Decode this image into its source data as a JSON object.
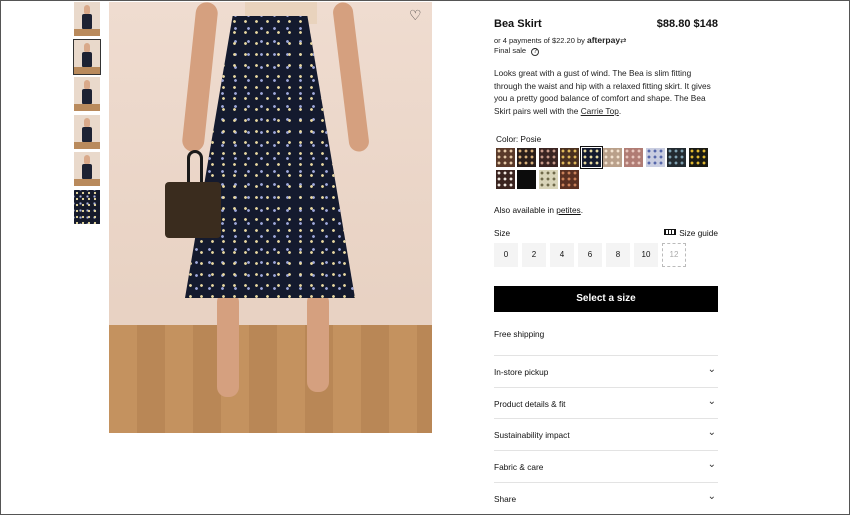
{
  "gallery": {
    "thumb_count": 6,
    "selected_index": 1
  },
  "product": {
    "title": "Bea Skirt",
    "sale_price": "$88.80",
    "original_price": "$148",
    "payments_text": "or 4 payments of $22.20 by",
    "payments_brand": "afterpay",
    "final_sale": "Final sale",
    "description_main": "Looks great with a gust of wind. The Bea is slim fitting through the waist and hip with a relaxed fitting skirt. It gives you a pretty good balance of comfort and shape. The Bea Skirt pairs well with the ",
    "description_link": "Carrie Top",
    "description_end": "."
  },
  "color": {
    "label": "Color: Posie",
    "selected_index": 4,
    "swatches": [
      {
        "name": "swatch-1",
        "bg": "#5a3a2a",
        "dot": "#e6c9a8"
      },
      {
        "name": "swatch-2",
        "bg": "#2a1e1a",
        "dot": "#d8b07a"
      },
      {
        "name": "swatch-3",
        "bg": "#3a2422",
        "dot": "#c79a8a"
      },
      {
        "name": "swatch-4",
        "bg": "#4a3020",
        "dot": "#e0b85a"
      },
      {
        "name": "swatch-5",
        "bg": "#141a2e",
        "dot": "#e6d9a0"
      },
      {
        "name": "swatch-6",
        "bg": "#b9a08a",
        "dot": "#f2e2cf"
      },
      {
        "name": "swatch-7",
        "bg": "#b07c74",
        "dot": "#e8c6bd"
      },
      {
        "name": "swatch-8",
        "bg": "#c9cde0",
        "dot": "#5566aa"
      },
      {
        "name": "swatch-9",
        "bg": "#222a30",
        "dot": "#7fa0b0"
      },
      {
        "name": "swatch-10",
        "bg": "#1a1a14",
        "dot": "#e0b830"
      },
      {
        "name": "swatch-11",
        "bg": "#3a2420",
        "dot": "#f0e8e0"
      },
      {
        "name": "swatch-12",
        "bg": "#0c0c0c",
        "dot": "#0c0c0c"
      },
      {
        "name": "swatch-13",
        "bg": "#d8d4b8",
        "dot": "#6f6a4a"
      },
      {
        "name": "swatch-14",
        "bg": "#5a3022",
        "dot": "#c9805a"
      }
    ]
  },
  "availability": {
    "text": "Also available in ",
    "link": "petites",
    "end": "."
  },
  "size": {
    "label": "Size",
    "guide_label": "Size guide",
    "options": [
      "0",
      "2",
      "4",
      "6",
      "8",
      "10",
      "12"
    ],
    "unavailable": [
      "12"
    ]
  },
  "cta": {
    "label": "Select a size"
  },
  "shipping": "Free shipping",
  "accordions": [
    "In-store pickup",
    "Product details & fit",
    "Sustainability impact",
    "Fabric & care",
    "Share"
  ]
}
